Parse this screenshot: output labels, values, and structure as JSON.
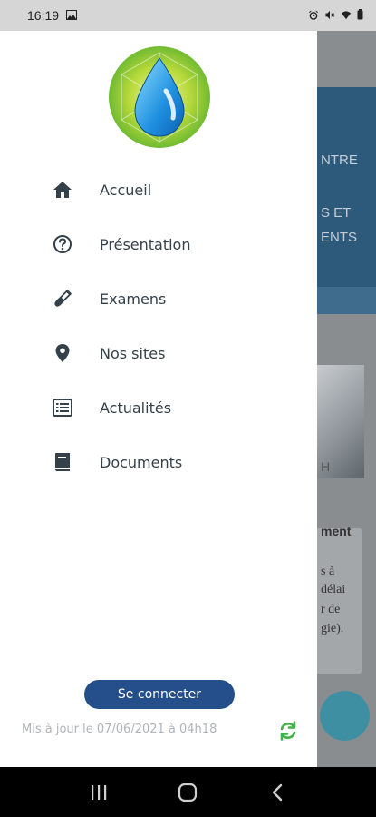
{
  "statusbar": {
    "time": "16:19",
    "icons": [
      "gallery-icon",
      "alarm-icon",
      "mute-icon",
      "wifi-icon",
      "battery-icon"
    ]
  },
  "background": {
    "line1": "NTRE",
    "line2": "S ET",
    "line3": "ENTS",
    "photo_caption": "H",
    "card_title": "ment",
    "card_lines": [
      "s  à",
      "délai",
      "r de",
      "gie)."
    ]
  },
  "drawer": {
    "logo": "water-drop-logo",
    "menu": [
      {
        "label": "Accueil",
        "icon": "home-icon"
      },
      {
        "label": "Présentation",
        "icon": "help-circle-icon"
      },
      {
        "label": "Examens",
        "icon": "test-tube-icon"
      },
      {
        "label": "Nos sites",
        "icon": "map-pin-icon"
      },
      {
        "label": "Actualités",
        "icon": "newspaper-list-icon"
      },
      {
        "label": "Documents",
        "icon": "book-icon"
      }
    ],
    "connect_label": "Se connecter",
    "updated_text": "Mis à jour le 07/06/2021 à 04h18",
    "refresh_icon": "refresh-icon"
  },
  "navbar": {
    "buttons": [
      "recent-apps-icon",
      "home-button-icon",
      "back-icon"
    ]
  },
  "colors": {
    "accent": "#244f8a",
    "refresh": "#3fb34a",
    "menu_text": "#34404a"
  }
}
